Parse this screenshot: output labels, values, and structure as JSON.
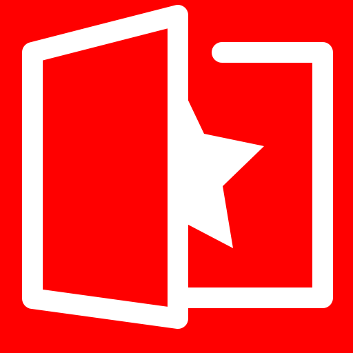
{
  "icon": {
    "name": "open-door-with-star",
    "background_color": "#FF0000",
    "stroke_color": "#FFFFFF",
    "parts": [
      "door-frame-icon",
      "door-panel-icon",
      "star-icon"
    ]
  }
}
